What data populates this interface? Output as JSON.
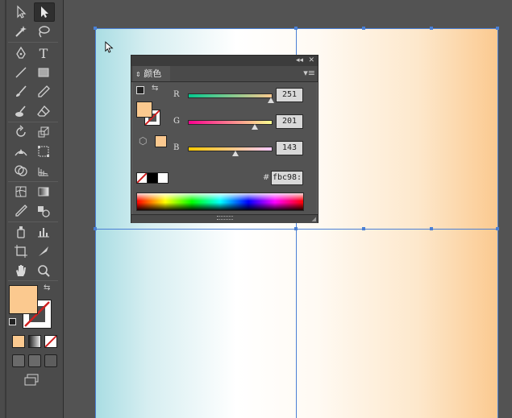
{
  "toolbar": {
    "tools": [
      {
        "name": "selection-tool",
        "icon": "arrow-outline-icon"
      },
      {
        "name": "direct-selection-tool",
        "icon": "arrow-filled-icon",
        "active": true
      },
      {
        "name": "magic-wand-tool",
        "icon": "magic-wand-icon"
      },
      {
        "name": "lasso-tool",
        "icon": "lasso-icon"
      },
      {
        "name": "pen-tool",
        "icon": "pen-icon"
      },
      {
        "name": "type-tool",
        "icon": "type-icon",
        "label": "T"
      },
      {
        "name": "line-tool",
        "icon": "line-icon"
      },
      {
        "name": "rectangle-tool",
        "icon": "rectangle-icon"
      },
      {
        "name": "paintbrush-tool",
        "icon": "brush-icon"
      },
      {
        "name": "pencil-tool",
        "icon": "pencil-icon"
      },
      {
        "name": "blob-brush-tool",
        "icon": "blob-brush-icon"
      },
      {
        "name": "eraser-tool",
        "icon": "eraser-icon"
      },
      {
        "name": "rotate-tool",
        "icon": "rotate-icon"
      },
      {
        "name": "scale-tool",
        "icon": "scale-icon"
      },
      {
        "name": "width-tool",
        "icon": "width-icon"
      },
      {
        "name": "free-transform-tool",
        "icon": "free-transform-icon"
      },
      {
        "name": "shape-builder-tool",
        "icon": "shape-builder-icon"
      },
      {
        "name": "perspective-grid-tool",
        "icon": "perspective-grid-icon"
      },
      {
        "name": "mesh-tool",
        "icon": "mesh-icon"
      },
      {
        "name": "gradient-tool",
        "icon": "gradient-icon"
      },
      {
        "name": "eyedropper-tool",
        "icon": "eyedropper-icon"
      },
      {
        "name": "blend-tool",
        "icon": "blend-icon"
      },
      {
        "name": "symbol-sprayer-tool",
        "icon": "symbol-sprayer-icon"
      },
      {
        "name": "column-graph-tool",
        "icon": "column-graph-icon"
      },
      {
        "name": "artboard-tool",
        "icon": "artboard-icon"
      },
      {
        "name": "slice-tool",
        "icon": "slice-icon"
      },
      {
        "name": "hand-tool",
        "icon": "hand-icon"
      },
      {
        "name": "zoom-tool",
        "icon": "zoom-icon"
      }
    ],
    "fill_color": "#fbc98f",
    "stroke_color": "none"
  },
  "color_panel": {
    "title": "颜色",
    "channels": [
      {
        "label": "R",
        "value": "251",
        "fraction": 0.984,
        "gradient": "linear-gradient(to right,#04c98f,#fbc98f)"
      },
      {
        "label": "G",
        "value": "201",
        "fraction": 0.788,
        "gradient": "linear-gradient(to right,#fb008f,#fbff8f)"
      },
      {
        "label": "B",
        "value": "143",
        "fraction": 0.561,
        "gradient": "linear-gradient(to right,#fbc900,#fbc9ff)"
      }
    ],
    "hex_label": "#",
    "hex_value": "fbc98:",
    "current_color": "#fbc98f"
  },
  "colors": {
    "selection_guide": "#4a7fd4",
    "panel_bg": "#535353",
    "artboard_left": "#a9dde3",
    "artboard_right": "#fbc98f"
  }
}
